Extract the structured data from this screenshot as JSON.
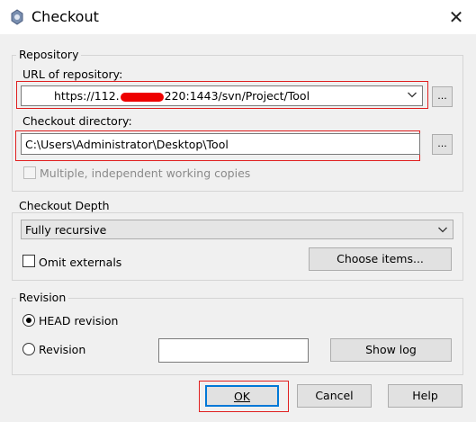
{
  "window": {
    "title": "Checkout",
    "close_glyph": "✕"
  },
  "repository": {
    "group_label": "Repository",
    "url_label": "URL of repository:",
    "url_prefix": "https://112.",
    "url_suffix": "220:1443/svn/Project/Tool",
    "browse_label": "...",
    "dir_label": "Checkout directory:",
    "dir_value": "C:\\Users\\Administrator\\Desktop\\Tool",
    "dir_browse_label": "...",
    "multiple_label": "Multiple, independent working copies",
    "multiple_checked": false
  },
  "depth": {
    "group_label": "Checkout Depth",
    "selected": "Fully recursive",
    "omit_label": "Omit externals",
    "omit_checked": false,
    "choose_label": "Choose items..."
  },
  "revision": {
    "group_label": "Revision",
    "head_label": "HEAD revision",
    "revision_label": "Revision",
    "revision_value": "",
    "selected": "HEAD revision",
    "show_log_label": "Show log"
  },
  "footer": {
    "ok_label": "OK",
    "cancel_label": "Cancel",
    "help_label": "Help"
  },
  "colors": {
    "highlight": "#e02020",
    "redaction": "#ee0000",
    "ok_border": "#0078d7"
  },
  "icons": [
    "app-icon",
    "close-icon",
    "chevron-down-icon"
  ]
}
